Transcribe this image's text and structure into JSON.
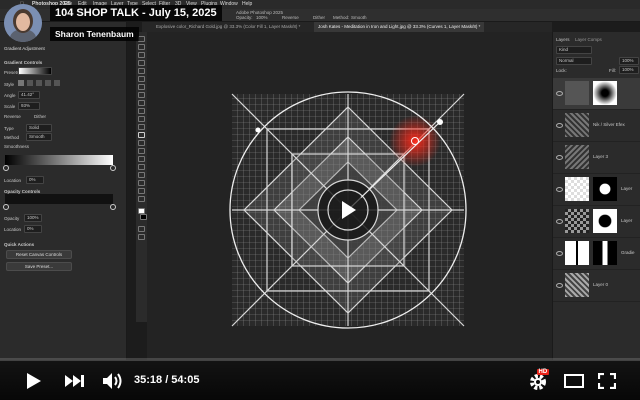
{
  "menubar": {
    "app": "Photoshop 2025",
    "items": [
      "File",
      "Edit",
      "Image",
      "Layer",
      "Type",
      "Select",
      "Filter",
      "3D",
      "View",
      "Plugins",
      "Window",
      "Help"
    ],
    "window_title": "Adobe Photoshop 2025"
  },
  "options": {
    "opacity_label": "Opacity:",
    "opacity_value": "100%",
    "reverse": "Reverse",
    "dither": "Dither",
    "method_label": "Method:",
    "method_value": "Smooth"
  },
  "tabs": [
    {
      "label": "Explosive color_Richard Gold.jpg @ 33.3% (Color Fill 1, Layer Mask/8) *"
    },
    {
      "label": "Josh Kates - Meditation in Iron and Light.jpg @ 33.3% (Curves 1, Layer Mask/8) *"
    }
  ],
  "left_panel": {
    "header": "Gradient Adjustment",
    "section_gradient": "Gradient Controls",
    "preset": "Presets",
    "style": "Style",
    "angle_label": "Angle",
    "angle_value": "41.42°",
    "scale_label": "Scale",
    "scale_value": "93%",
    "reverse": "Reverse",
    "dither": "Dither",
    "type_label": "Type",
    "type_value": "Solid",
    "method_label": "Method",
    "method_value": "Smooth",
    "smoothness_label": "Smoothness",
    "location_label": "Location",
    "location_value": "0%",
    "section_opacity": "Opacity Controls",
    "opacity_label": "Opacity",
    "opacity_value": "100%",
    "location2_value": "0%",
    "section_quick": "Quick Actions",
    "reset_button": "Reset Canvas Controls",
    "save_button": "Save Preset..."
  },
  "layers_panel": {
    "tab_layers": "Layers",
    "tab_layer_comps": "Layer Comps",
    "kind": "Kind",
    "blend_mode": "Normal",
    "opacity_value": "100%",
    "lock_label": "Lock:",
    "fill_label": "Fill:",
    "fill_value": "100%",
    "layers": [
      {
        "name": ""
      },
      {
        "name": "Nik / Silver Efex"
      },
      {
        "name": "Layer 3"
      },
      {
        "name": "Layer"
      },
      {
        "name": "Layer"
      },
      {
        "name": "Gradie"
      },
      {
        "name": "Layer 0"
      }
    ]
  },
  "video": {
    "title": "104 SHOP TALK - July 15, 2025",
    "channel": "Sharon Tenenbaum",
    "time_current": "35:18",
    "time_total": "54:05",
    "time_display": "35:18 / 54:05",
    "hd_badge": "HD"
  }
}
